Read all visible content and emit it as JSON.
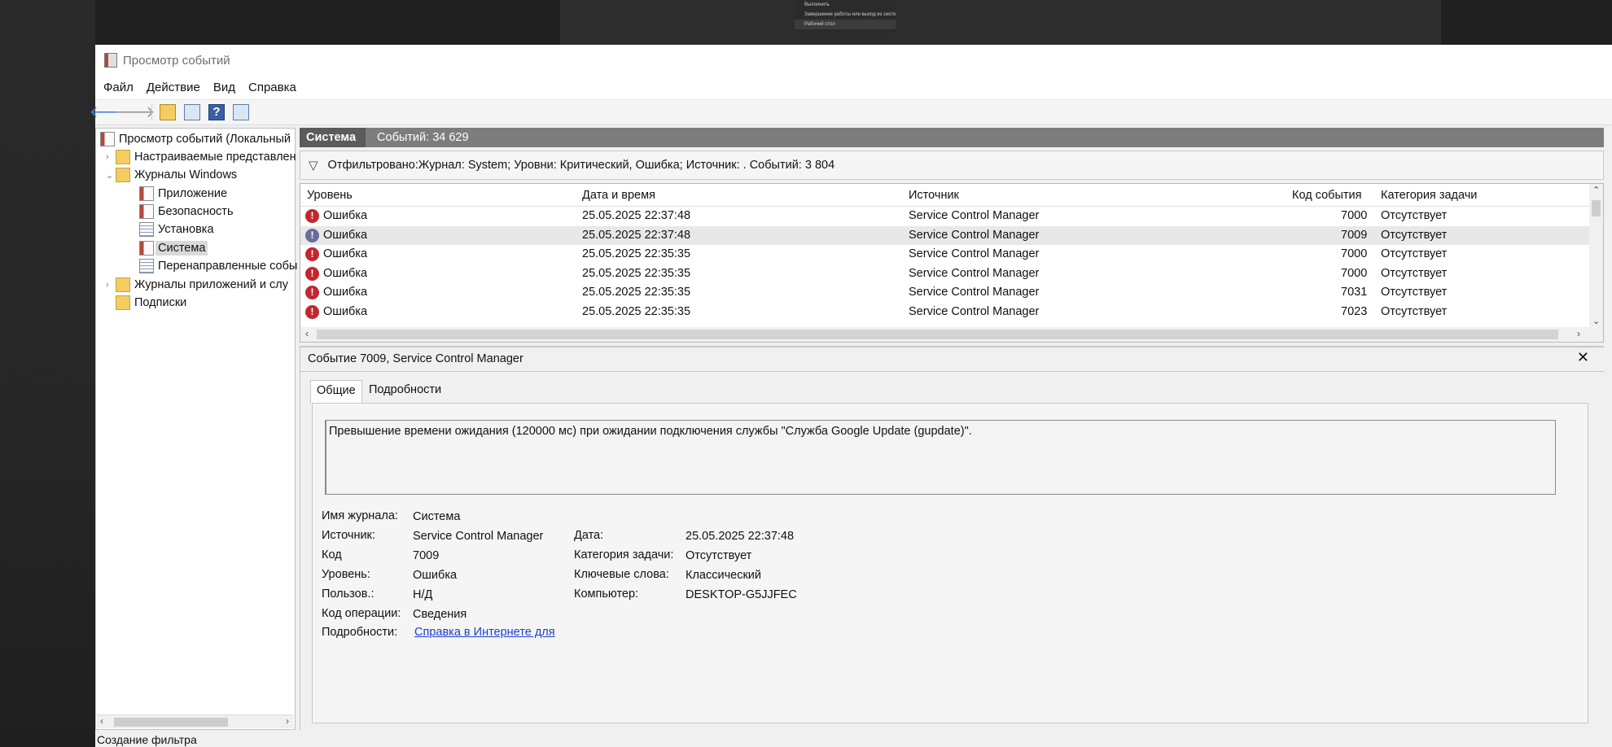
{
  "background": {
    "context_menu_items": [
      "Выполнить",
      "Завершение работы или выход из системы",
      "Рабочий стол"
    ]
  },
  "window": {
    "title": "Просмотр событий",
    "menu": [
      "Файл",
      "Действие",
      "Вид",
      "Справка"
    ],
    "toolbar_icons": [
      "back-arrow-icon",
      "forward-arrow-icon",
      "open-folder-icon",
      "console-tree-icon",
      "help-icon",
      "action-pane-icon"
    ],
    "status": "Создание фильтра"
  },
  "tree": {
    "root": "Просмотр событий (Локальный",
    "custom_views": "Настраиваемые представлен",
    "windows_logs": "Журналы Windows",
    "app": "Приложение",
    "security": "Безопасность",
    "setup": "Установка",
    "system": "Система",
    "forwarded": "Перенаправленные собы",
    "app_service_logs": "Журналы приложений и слу",
    "subscriptions": "Подписки"
  },
  "panel": {
    "name": "Система",
    "count": "Событий: 34 629",
    "filter": "Отфильтровано:Журнал: System; Уровни: Критический, Ошибка; Источник: . Событий: 3 804"
  },
  "grid": {
    "columns": [
      "Уровень",
      "Дата и время",
      "Источник",
      "Код события",
      "Категория задачи"
    ],
    "rows": [
      {
        "level": "Ошибка",
        "date": "25.05.2025 22:37:48",
        "source": "Service Control Manager",
        "code": "7000",
        "category": "Отсутствует"
      },
      {
        "level": "Ошибка",
        "date": "25.05.2025 22:37:48",
        "source": "Service Control Manager",
        "code": "7009",
        "category": "Отсутствует"
      },
      {
        "level": "Ошибка",
        "date": "25.05.2025 22:35:35",
        "source": "Service Control Manager",
        "code": "7000",
        "category": "Отсутствует"
      },
      {
        "level": "Ошибка",
        "date": "25.05.2025 22:35:35",
        "source": "Service Control Manager",
        "code": "7000",
        "category": "Отсутствует"
      },
      {
        "level": "Ошибка",
        "date": "25.05.2025 22:35:35",
        "source": "Service Control Manager",
        "code": "7031",
        "category": "Отсутствует"
      },
      {
        "level": "Ошибка",
        "date": "25.05.2025 22:35:35",
        "source": "Service Control Manager",
        "code": "7023",
        "category": "Отсутствует"
      }
    ]
  },
  "detail": {
    "title": "Событие 7009, Service Control Manager",
    "tabs": [
      "Общие",
      "Подробности"
    ],
    "message": "Превышение времени ожидания (120000 мс) при ожидании подключения службы \"Служба Google Update (gupdate)\".",
    "labels": {
      "log_name": "Имя журнала:",
      "source": "Источник:",
      "code": "Код",
      "level": "Уровень:",
      "user": "Пользов.:",
      "opcode": "Код операции:",
      "more": "Подробности:",
      "date": "Дата:",
      "task_category": "Категория задачи:",
      "keywords": "Ключевые слова:",
      "computer": "Компьютер:"
    },
    "values": {
      "log_name": "Система",
      "source": "Service Control Manager",
      "code": "7009",
      "level": "Ошибка",
      "user": "Н/Д",
      "opcode": "Сведения",
      "more_link": "Справка в Интернете для",
      "date": "25.05.2025 22:37:48",
      "task_category": "Отсутствует",
      "keywords": "Классический",
      "computer": "DESKTOP-G5JJFEC"
    }
  }
}
